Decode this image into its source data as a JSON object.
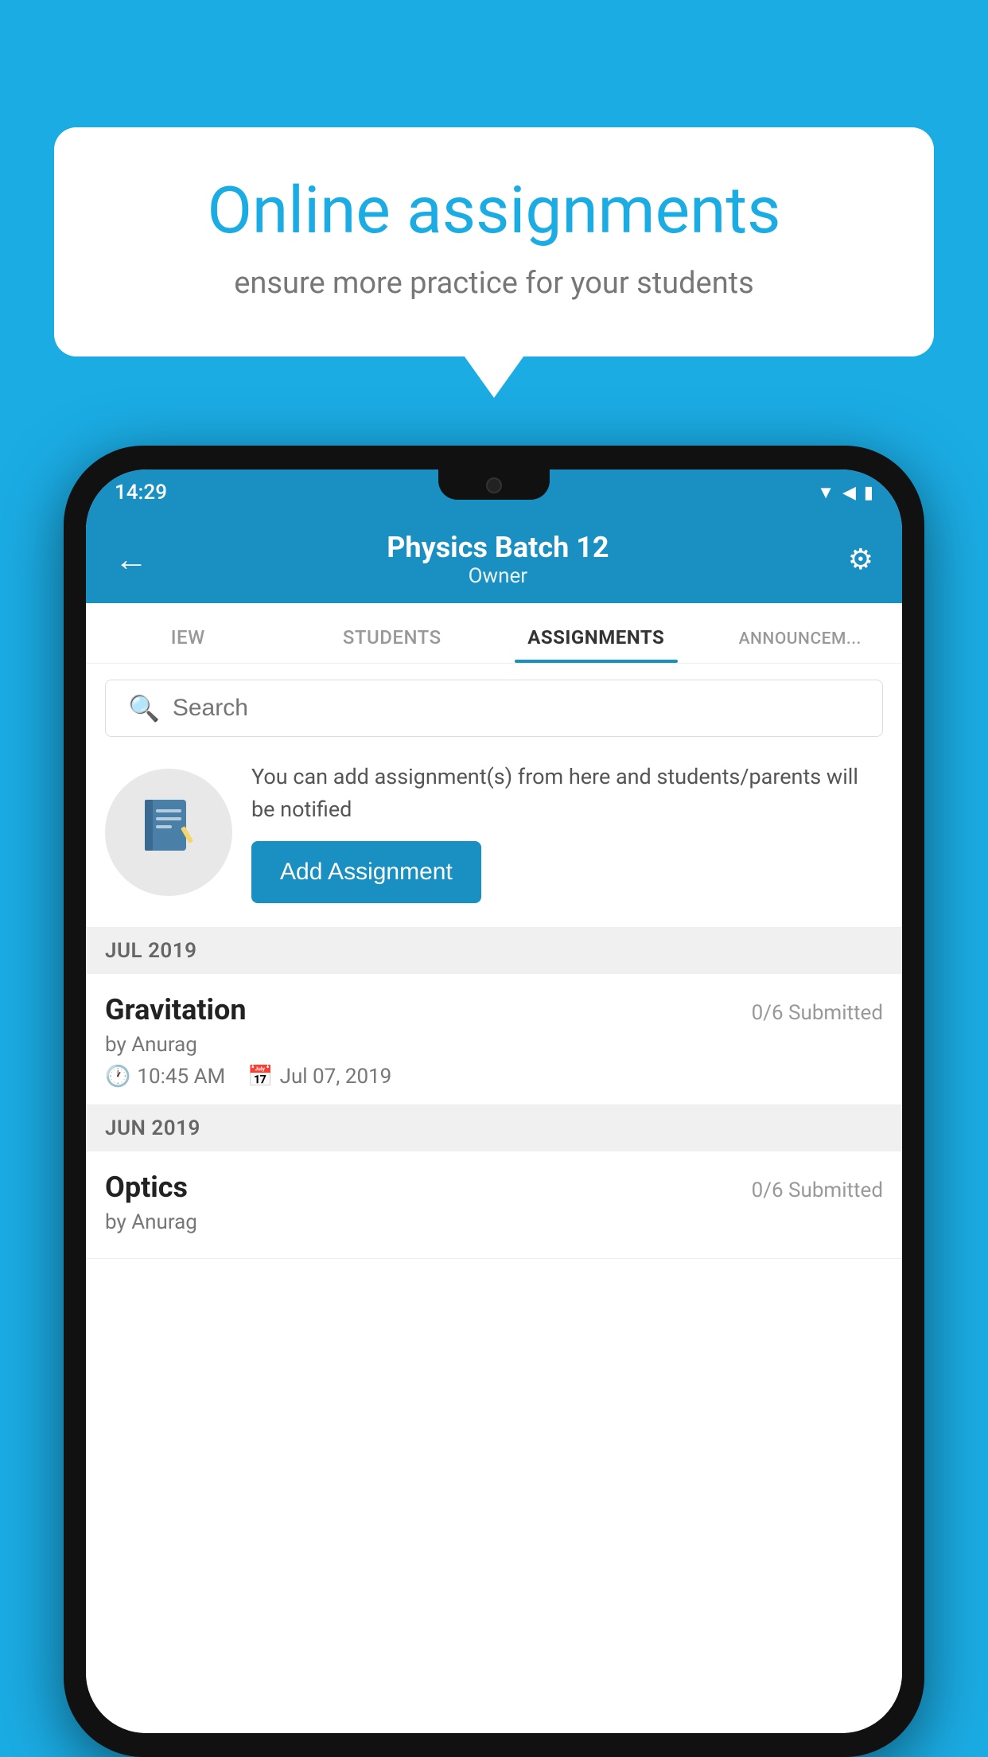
{
  "background_color": "#1BACE4",
  "speech_bubble": {
    "title": "Online assignments",
    "subtitle": "ensure more practice for your students"
  },
  "status_bar": {
    "time": "14:29",
    "wifi": "▲",
    "signal": "▲",
    "battery": "▮"
  },
  "header": {
    "back_label": "←",
    "title": "Physics Batch 12",
    "subtitle": "Owner",
    "settings_label": "⚙"
  },
  "tabs": [
    {
      "label": "IEW",
      "active": false
    },
    {
      "label": "STUDENTS",
      "active": false
    },
    {
      "label": "ASSIGNMENTS",
      "active": true
    },
    {
      "label": "ANNOUNCEM...",
      "active": false
    }
  ],
  "search": {
    "placeholder": "Search"
  },
  "promo": {
    "icon": "📓",
    "text": "You can add assignment(s) from here and students/parents will be notified",
    "button_label": "Add Assignment"
  },
  "sections": [
    {
      "label": "JUL 2019",
      "assignments": [
        {
          "name": "Gravitation",
          "submitted": "0/6 Submitted",
          "by": "by Anurag",
          "time": "10:45 AM",
          "date": "Jul 07, 2019"
        }
      ]
    },
    {
      "label": "JUN 2019",
      "assignments": [
        {
          "name": "Optics",
          "submitted": "0/6 Submitted",
          "by": "by Anurag",
          "time": "",
          "date": ""
        }
      ]
    }
  ]
}
